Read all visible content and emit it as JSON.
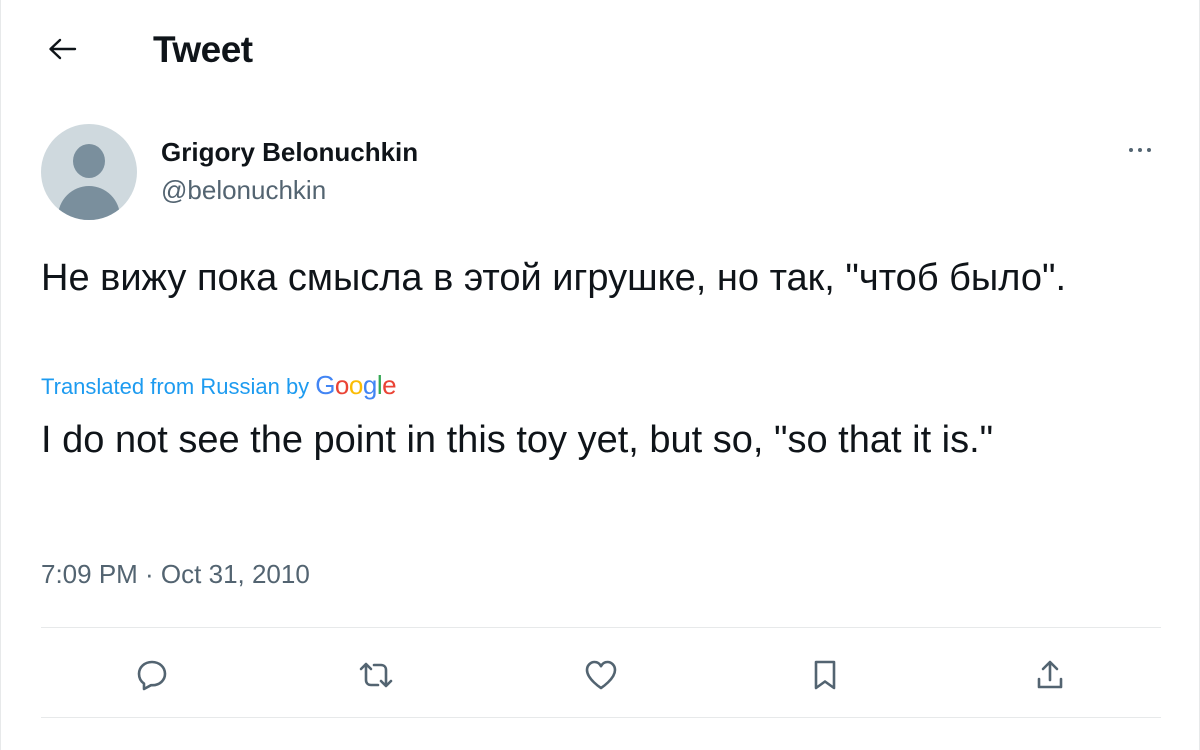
{
  "header": {
    "title": "Tweet"
  },
  "author": {
    "display_name": "Grigory Belonuchkin",
    "handle": "@belonuchkin"
  },
  "tweet": {
    "original_text": "Не вижу пока смысла в этой игрушке, но так, \"чтоб было\".",
    "translation_label": "Translated from Russian by",
    "translation_provider": "Google",
    "translated_text": "I do not see the point in this toy yet, but so, \"so that it is.\"",
    "timestamp": "7:09 PM · Oct 31, 2010"
  },
  "actions": [
    "reply-icon",
    "retweet-icon",
    "like-icon",
    "bookmark-icon",
    "share-icon"
  ],
  "colors": {
    "text_primary": "#0f1419",
    "text_secondary": "#536471",
    "link_blue": "#1d9bf0",
    "divider": "#e7e9ea",
    "avatar_bg": "#cfd9de"
  }
}
